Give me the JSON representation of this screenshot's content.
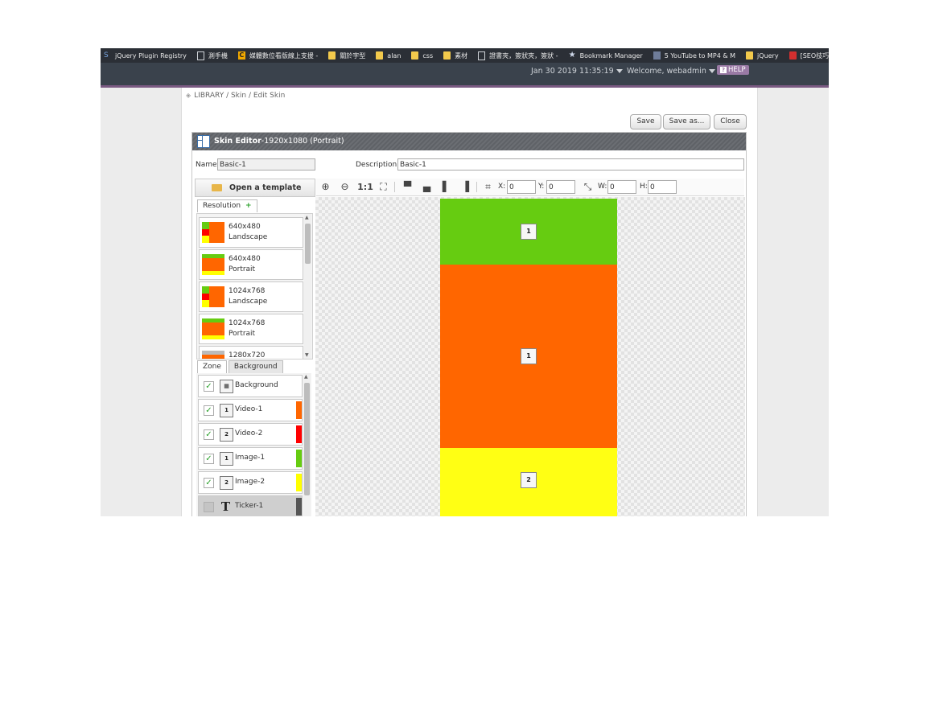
{
  "bookmarks": [
    {
      "label": "jQuery Plugin Registry",
      "icon": "s-icon"
    },
    {
      "label": "測手機",
      "icon": "page-icon"
    },
    {
      "label": "媒體數位看版線上支援 -",
      "icon": "c-icon"
    },
    {
      "label": "關於字型",
      "icon": "folder-icon"
    },
    {
      "label": "alan",
      "icon": "folder-icon"
    },
    {
      "label": "css",
      "icon": "folder-icon"
    },
    {
      "label": "素材",
      "icon": "folder-icon"
    },
    {
      "label": "證書夾，簽狀夾，簽狀 -",
      "icon": "page-icon"
    },
    {
      "label": "Bookmark Manager",
      "icon": "star-icon"
    },
    {
      "label": "5 YouTube to MP4 & M",
      "icon": "youtube-icon"
    },
    {
      "label": "jQuery",
      "icon": "folder-icon"
    },
    {
      "label": "[SEO技巧]善用搜尋如何",
      "icon": "red-icon"
    }
  ],
  "header": {
    "datetime": "Jan 30 2019 11:35:19",
    "welcome": "Welcome, webadmin",
    "help": "HELP",
    "colors": {
      "bar": "#3a424c",
      "accent": "#7a5a82"
    }
  },
  "breadcrumb": "LIBRARY / Skin / Edit Skin",
  "actions": {
    "save": "Save",
    "save_as": "Save as...",
    "close": "Close"
  },
  "editor": {
    "title_bold": "Skin Editor",
    "title_rest": "-1920x1080  (Portrait)",
    "name_label": "Name",
    "name_value": "Basic-1",
    "desc_label": "Description",
    "desc_value": "Basic-1",
    "open_template": "Open a template"
  },
  "resolution_tab": "Resolution",
  "resolutions": [
    {
      "size": "640x480",
      "orientation": "Landscape"
    },
    {
      "size": "640x480",
      "orientation": "Portrait"
    },
    {
      "size": "1024x768",
      "orientation": "Landscape"
    },
    {
      "size": "1024x768",
      "orientation": "Portrait"
    },
    {
      "size": "1280x720",
      "orientation": ""
    }
  ],
  "zone_tabs": {
    "zone": "Zone",
    "background": "Background"
  },
  "zones": [
    {
      "name": "Background",
      "checked": true,
      "icon": "background-icon",
      "icon_text": "",
      "color": ""
    },
    {
      "name": "Video-1",
      "checked": true,
      "icon": "video-icon",
      "icon_text": "1",
      "color": "#ff6600"
    },
    {
      "name": "Video-2",
      "checked": true,
      "icon": "video-icon",
      "icon_text": "2",
      "color": "#ff0000"
    },
    {
      "name": "Image-1",
      "checked": true,
      "icon": "image-icon",
      "icon_text": "1",
      "color": "#66cc11"
    },
    {
      "name": "Image-2",
      "checked": true,
      "icon": "image-icon",
      "icon_text": "2",
      "color": "#ffff00"
    },
    {
      "name": "Ticker-1",
      "checked": false,
      "icon": "ticker-icon",
      "icon_text": "T",
      "color": "#555555"
    }
  ],
  "toolbar": {
    "one_to_one": "1:1",
    "x_label": "X:",
    "x_value": "0",
    "y_label": "Y:",
    "y_value": "0",
    "w_label": "W:",
    "w_value": "0",
    "h_label": "H:",
    "h_value": "0"
  },
  "canvas_zones": [
    {
      "name": "image-1-zone",
      "color": "#66cc11",
      "icon": "image-icon",
      "label": "1"
    },
    {
      "name": "video-1-zone",
      "color": "#ff6600",
      "icon": "video-icon",
      "label": "1"
    },
    {
      "name": "image-2-zone",
      "color": "#ffff14",
      "icon": "image-icon",
      "label": "2"
    }
  ]
}
